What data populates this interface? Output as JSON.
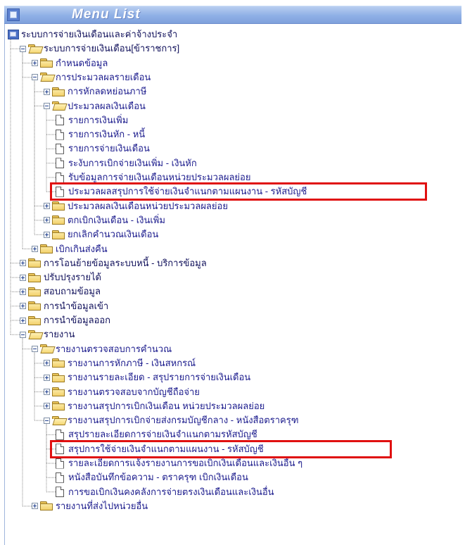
{
  "header": {
    "title": "Menu List",
    "top_mark": "ุ"
  },
  "tree": [
    {
      "id": "root",
      "label": "ระบบการจ่ายเงินเดือนและค่าจ้างประจำ",
      "icon": "system-icon",
      "toggle": "none"
    },
    {
      "id": "n1",
      "label": "ระบบการจ่ายเงินเดือน[ข้าราชการ]",
      "icon": "folder-open-icon",
      "toggle": "minus"
    },
    {
      "id": "n2",
      "label": "กำหนดข้อมูล",
      "icon": "folder-icon",
      "toggle": "plus"
    },
    {
      "id": "n3",
      "label": "การประมวลผลรายเดือน",
      "icon": "folder-open-icon",
      "toggle": "minus"
    },
    {
      "id": "n4",
      "label": "การหักลดหย่อนภาษี",
      "icon": "folder-icon",
      "toggle": "plus"
    },
    {
      "id": "n5",
      "label": "ประมวลผลเงินเดือน",
      "icon": "folder-open-icon",
      "toggle": "minus"
    },
    {
      "id": "n6",
      "label": "รายการเงินเพิ่ม",
      "icon": "document-icon",
      "toggle": "none"
    },
    {
      "id": "n7",
      "label": "รายการเงินหัก - หนี้",
      "icon": "document-icon",
      "toggle": "none"
    },
    {
      "id": "n8",
      "label": "รายการจ่ายเงินเดือน",
      "icon": "document-icon",
      "toggle": "none"
    },
    {
      "id": "n9",
      "label": "ระงับการเบิกจ่ายเงินเพิ่ม - เงินหัก",
      "icon": "document-icon",
      "toggle": "none"
    },
    {
      "id": "n10",
      "label": "รับข้อมูลการจ่ายเงินเดือนหน่วยประมวลผลย่อย",
      "icon": "document-icon",
      "toggle": "none"
    },
    {
      "id": "n11",
      "label": "ประมวลผลสรุปการใช้จ่ายเงินจำแนกตามแผนงาน - รหัสบัญชี",
      "icon": "document-icon",
      "toggle": "none"
    },
    {
      "id": "n12",
      "label": "ประมวลผลเงินเดือนหน่วยประมวลผลย่อย",
      "icon": "folder-icon",
      "toggle": "plus"
    },
    {
      "id": "n13",
      "label": "ตกเบิกเงินเดือน - เงินเพิ่ม",
      "icon": "folder-icon",
      "toggle": "plus"
    },
    {
      "id": "n14",
      "label": "ยกเลิกคำนวณเงินเดือน",
      "icon": "folder-icon",
      "toggle": "plus"
    },
    {
      "id": "n15",
      "label": "เบิกเกินส่งคืน",
      "icon": "folder-icon",
      "toggle": "plus"
    },
    {
      "id": "n16",
      "label": "การโอนย้ายข้อมูลระบบหนี้ - บริการข้อมูล",
      "icon": "folder-icon",
      "toggle": "plus"
    },
    {
      "id": "n17",
      "label": "ปรับปรุงรายได้",
      "icon": "folder-icon",
      "toggle": "plus"
    },
    {
      "id": "n18",
      "label": "สอบถามข้อมูล",
      "icon": "folder-icon",
      "toggle": "plus"
    },
    {
      "id": "n19",
      "label": "การนำข้อมูลเข้า",
      "icon": "folder-icon",
      "toggle": "plus"
    },
    {
      "id": "n20",
      "label": "การนำข้อมูลออก",
      "icon": "folder-icon",
      "toggle": "plus"
    },
    {
      "id": "n21",
      "label": "รายงาน",
      "icon": "folder-open-icon",
      "toggle": "minus"
    },
    {
      "id": "n22",
      "label": "รายงานตรวจสอบการคำนวณ",
      "icon": "folder-open-icon",
      "toggle": "minus"
    },
    {
      "id": "n23",
      "label": "รายงานการหักภาษี - เงินสหกรณ์",
      "icon": "folder-icon",
      "toggle": "plus"
    },
    {
      "id": "n24",
      "label": "รายงานรายละเอียด - สรุปรายการจ่ายเงินเดือน",
      "icon": "folder-icon",
      "toggle": "plus"
    },
    {
      "id": "n25",
      "label": "รายงานตรวจสอบจากบัญชีถือจ่าย",
      "icon": "folder-icon",
      "toggle": "plus"
    },
    {
      "id": "n26",
      "label": "รายงานสรุปการเบิกเงินเดือน หน่วยประมวลผลย่อย",
      "icon": "folder-icon",
      "toggle": "plus"
    },
    {
      "id": "n27",
      "label": "รายงานสรุปการเบิกจ่ายส่งกรมบัญชีกลาง - หนังสือตราครุฑ",
      "icon": "folder-open-icon",
      "toggle": "minus"
    },
    {
      "id": "n28",
      "label": "สรุปรายละเอียดการจ่ายเงินจำแนกตามรหัสบัญชี",
      "icon": "document-icon",
      "toggle": "none"
    },
    {
      "id": "n29",
      "label": "สรุปการใช้จ่ายเงินจำแนกตามแผนงาน - รหัสบัญชี",
      "icon": "document-icon",
      "toggle": "none"
    },
    {
      "id": "n30",
      "label": "รายละเอียดการแจ้งรายงานการขอเบิกเงินเดือนและเงินอื่น ๆ",
      "icon": "document-icon",
      "toggle": "none"
    },
    {
      "id": "n31",
      "label": "หนังสือบันทึกข้อความ - ตราครุฑ เบิกเงินเดือน",
      "icon": "document-icon",
      "toggle": "none"
    },
    {
      "id": "n32",
      "label": "การขอเบิกเงินคงคลังการจ่ายตรงเงินเดือนและเงินอื่น",
      "icon": "document-icon",
      "toggle": "none"
    },
    {
      "id": "n33",
      "label": "รายงานที่ส่งไปหน่วยอื่น",
      "icon": "folder-icon",
      "toggle": "plus"
    }
  ],
  "highlight_color": "#e01010"
}
